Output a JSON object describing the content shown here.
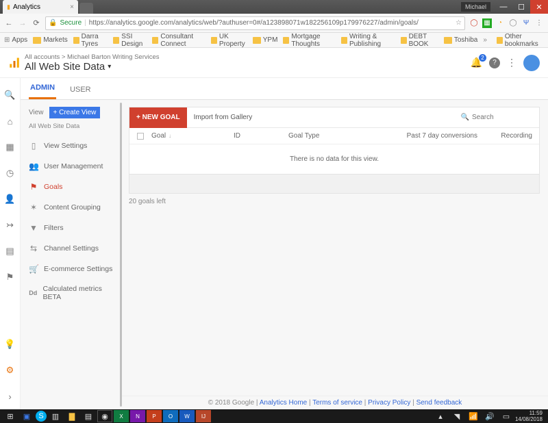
{
  "browser": {
    "tab_title": "Analytics",
    "user_chip": "Michael",
    "secure_label": "Secure",
    "url": "https://analytics.google.com/analytics/web/?authuser=0#/a123898071w182256109p179976227/admin/goals/"
  },
  "bookmarks": {
    "apps": "Apps",
    "items": [
      "Markets",
      "Darra Tyres",
      "SSI Design",
      "Consultant Connect",
      "UK Property",
      "YPM",
      "Mortgage Thoughts",
      "Writing & Publishing",
      "DEBT BOOK",
      "Toshiba"
    ],
    "more": "»",
    "other": "Other bookmarks"
  },
  "header": {
    "breadcrumb": "All accounts > Michael Barton Writing Services",
    "view_name": "All Web Site Data",
    "notif_count": "2"
  },
  "tabs": {
    "admin": "ADMIN",
    "user": "USER"
  },
  "view_col": {
    "label": "View",
    "create": "+  Create View",
    "subtitle": "All Web Site Data",
    "items": [
      {
        "icon": "file",
        "label": "View Settings"
      },
      {
        "icon": "users",
        "label": "User Management"
      },
      {
        "icon": "flag",
        "label": "Goals",
        "active": true
      },
      {
        "icon": "groups",
        "label": "Content Grouping"
      },
      {
        "icon": "filter",
        "label": "Filters"
      },
      {
        "icon": "channel",
        "label": "Channel Settings"
      },
      {
        "icon": "cart",
        "label": "E-commerce Settings"
      },
      {
        "icon": "dd",
        "label": "Calculated metrics BETA"
      }
    ]
  },
  "panel": {
    "new_goal": "+ NEW GOAL",
    "import": "Import from Gallery",
    "search_placeholder": "Search",
    "cols": {
      "goal": "Goal",
      "id": "ID",
      "type": "Goal Type",
      "conv": "Past 7 day conversions",
      "rec": "Recording"
    },
    "empty": "There is no data for this view.",
    "goals_left": "20 goals left"
  },
  "footer": {
    "copyright": "© 2018 Google",
    "links": [
      "Analytics Home",
      "Terms of service",
      "Privacy Policy",
      "Send feedback"
    ]
  },
  "taskbar": {
    "time": "11:59",
    "date": "14/08/2018"
  }
}
